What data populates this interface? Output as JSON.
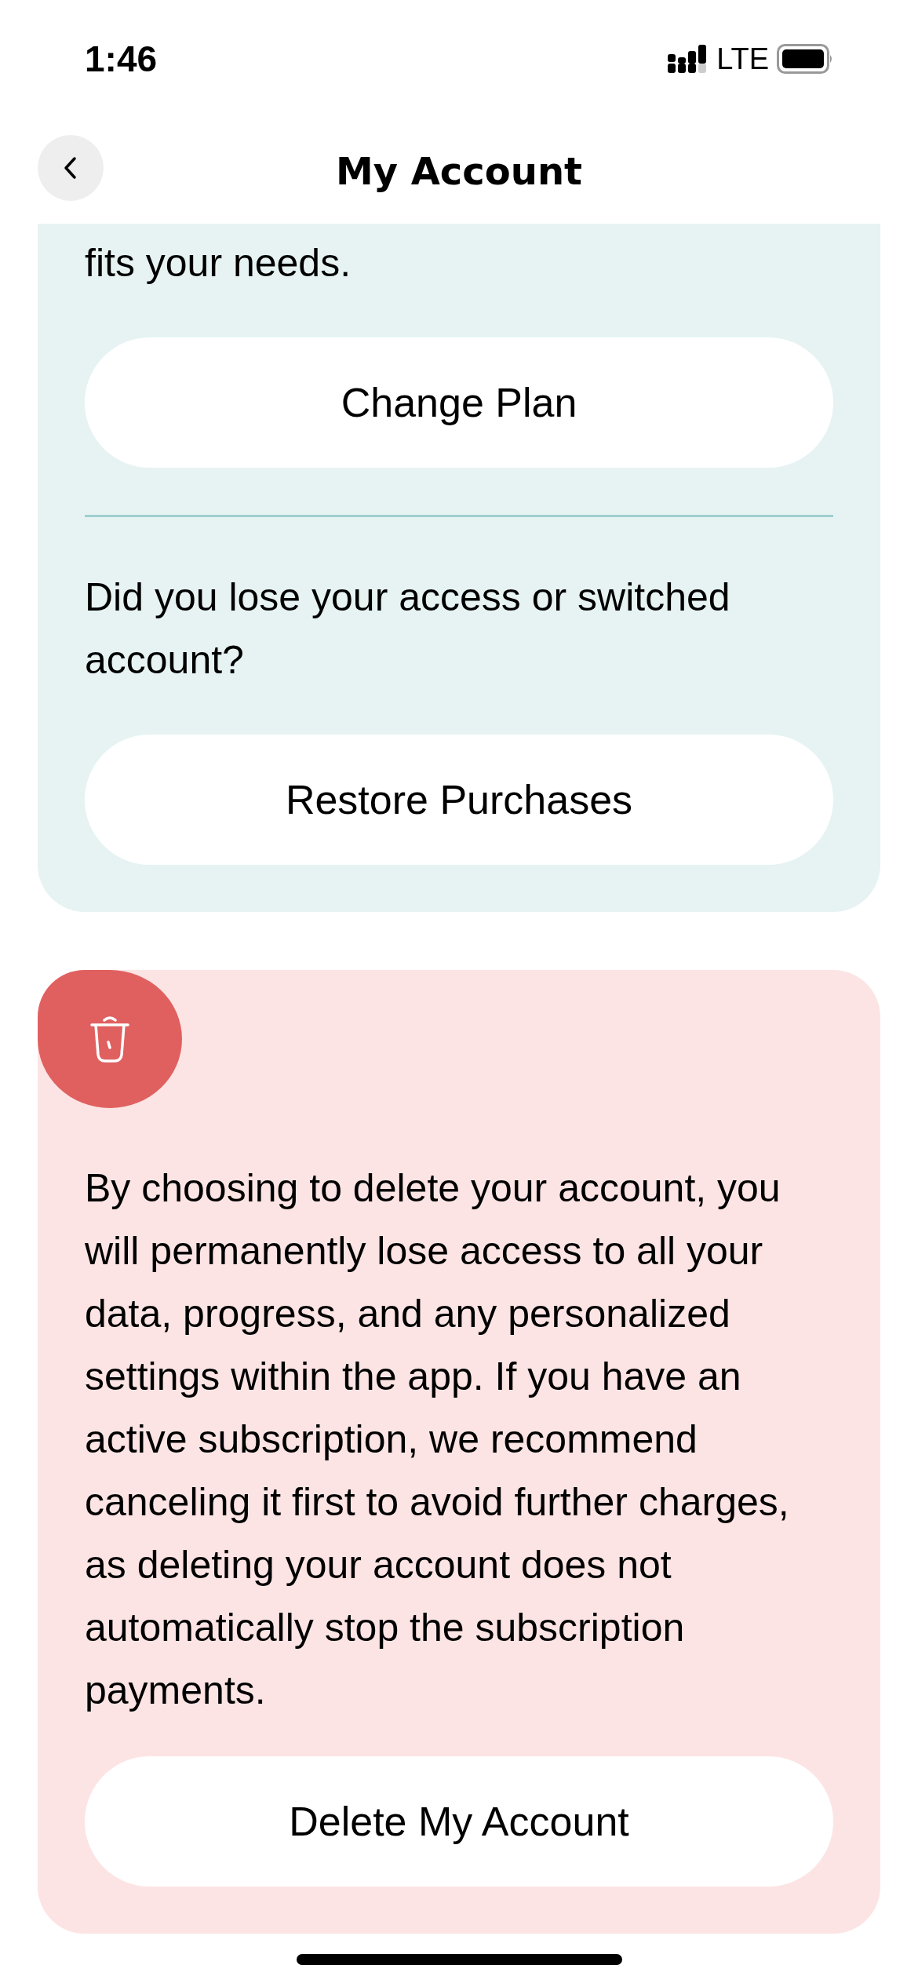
{
  "status_bar": {
    "time": "1:46",
    "network": "LTE"
  },
  "nav": {
    "title": "My Account"
  },
  "plan_card": {
    "intro": "fits your needs.",
    "change_button": "Change Plan",
    "question": "Did you lose your access or switched account?",
    "restore_button": "Restore Purchases"
  },
  "delete_card": {
    "text": "By choosing to delete your account, you will permanently lose access to all your data, progress, and any personalized settings within the app. If you have an active subscription, we recommend canceling it first to avoid further charges, as deleting your account does not automatically stop the subscription payments.",
    "delete_button": "Delete My Account"
  }
}
